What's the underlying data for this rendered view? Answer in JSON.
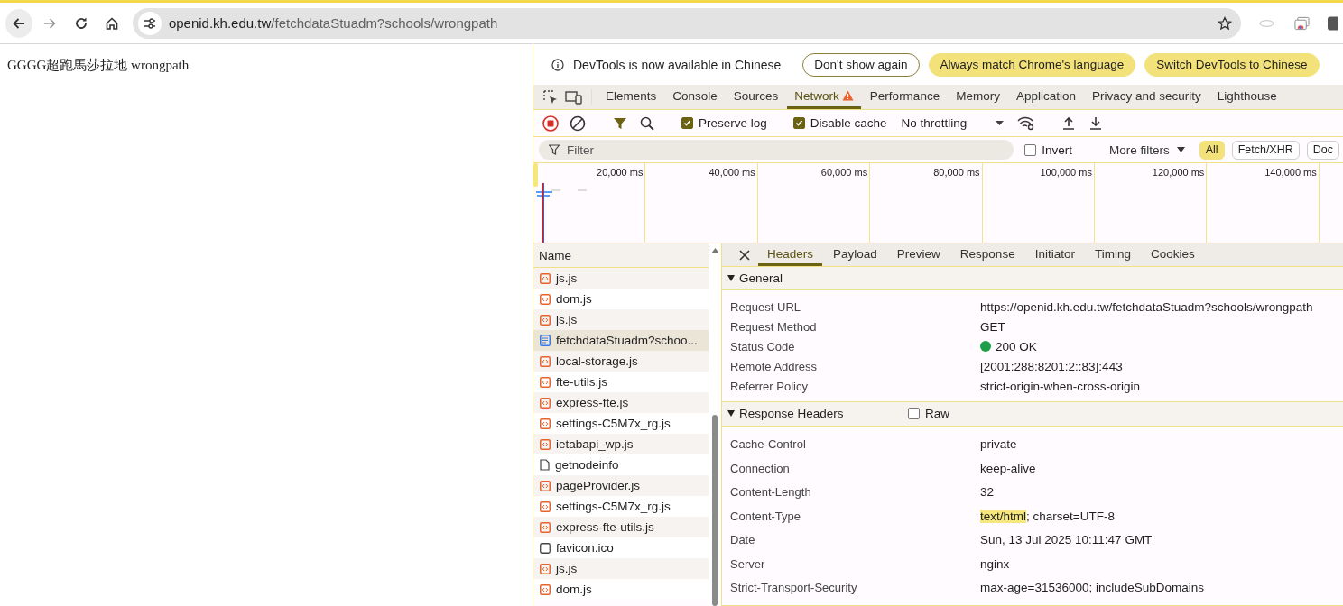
{
  "browser": {
    "url_host": "openid.kh.edu.tw",
    "url_path": "/fetchdataStuadm?schools/wrongpath"
  },
  "page": {
    "text": "GGGG超跑馬莎拉地 wrongpath"
  },
  "infobar": {
    "message": "DevTools is now available in Chinese",
    "buttons": [
      {
        "label": "Don't show again",
        "kind": "outline"
      },
      {
        "label": "Always match Chrome's language",
        "kind": "filled"
      },
      {
        "label": "Switch DevTools to Chinese",
        "kind": "filled"
      }
    ]
  },
  "panels": [
    {
      "label": "Elements",
      "selected": false,
      "warning": false
    },
    {
      "label": "Console",
      "selected": false,
      "warning": false
    },
    {
      "label": "Sources",
      "selected": false,
      "warning": false
    },
    {
      "label": "Network",
      "selected": true,
      "warning": true
    },
    {
      "label": "Performance",
      "selected": false,
      "warning": false
    },
    {
      "label": "Memory",
      "selected": false,
      "warning": false
    },
    {
      "label": "Application",
      "selected": false,
      "warning": false
    },
    {
      "label": "Privacy and security",
      "selected": false,
      "warning": false
    },
    {
      "label": "Lighthouse",
      "selected": false,
      "warning": false
    }
  ],
  "toolbar": {
    "recording": true,
    "options": [
      {
        "label": "Preserve log",
        "checked": true
      },
      {
        "label": "Disable cache",
        "checked": true
      }
    ],
    "throttling": "No throttling"
  },
  "filter": {
    "placeholder": "Filter",
    "invert": {
      "label": "Invert",
      "checked": false
    },
    "more_filters": "More filters",
    "types": [
      {
        "label": "All",
        "selected": true
      },
      {
        "label": "Fetch/XHR",
        "selected": false
      },
      {
        "label": "Doc",
        "selected": false
      }
    ]
  },
  "timeline": {
    "ticks": [
      "20,000 ms",
      "40,000 ms",
      "60,000 ms",
      "80,000 ms",
      "100,000 ms",
      "120,000 ms",
      "140,000 ms"
    ]
  },
  "requests": {
    "header": "Name",
    "items": [
      {
        "name": "js.js",
        "kind": "script",
        "selected": false
      },
      {
        "name": "dom.js",
        "kind": "script",
        "selected": false
      },
      {
        "name": "js.js",
        "kind": "script",
        "selected": false
      },
      {
        "name": "fetchdataStuadm?schoo...",
        "kind": "document",
        "selected": true
      },
      {
        "name": "local-storage.js",
        "kind": "script",
        "selected": false
      },
      {
        "name": "fte-utils.js",
        "kind": "script",
        "selected": false
      },
      {
        "name": "express-fte.js",
        "kind": "script",
        "selected": false
      },
      {
        "name": "settings-C5M7x_rg.js",
        "kind": "script",
        "selected": false
      },
      {
        "name": "ietabapi_wp.js",
        "kind": "script",
        "selected": false
      },
      {
        "name": "getnodeinfo",
        "kind": "fetch",
        "selected": false
      },
      {
        "name": "pageProvider.js",
        "kind": "script",
        "selected": false
      },
      {
        "name": "settings-C5M7x_rg.js",
        "kind": "script",
        "selected": false
      },
      {
        "name": "express-fte-utils.js",
        "kind": "script",
        "selected": false
      },
      {
        "name": "favicon.ico",
        "kind": "other",
        "selected": false
      },
      {
        "name": "js.js",
        "kind": "script",
        "selected": false
      },
      {
        "name": "dom.js",
        "kind": "script",
        "selected": false
      }
    ]
  },
  "details": {
    "tabs": [
      {
        "label": "Headers",
        "selected": true
      },
      {
        "label": "Payload",
        "selected": false
      },
      {
        "label": "Preview",
        "selected": false
      },
      {
        "label": "Response",
        "selected": false
      },
      {
        "label": "Initiator",
        "selected": false
      },
      {
        "label": "Timing",
        "selected": false
      },
      {
        "label": "Cookies",
        "selected": false
      }
    ],
    "sections": [
      {
        "title": "General",
        "expanded": true,
        "rows": [
          {
            "name": "Request URL",
            "value": "https://openid.kh.edu.tw/fetchdataStuadm?schools/wrongpath"
          },
          {
            "name": "Request Method",
            "value": "GET"
          },
          {
            "name": "Status Code",
            "value": "200 OK",
            "kind": "status"
          },
          {
            "name": "Remote Address",
            "value": "[2001:288:8201:2::83]:443"
          },
          {
            "name": "Referrer Policy",
            "value": "strict-origin-when-cross-origin"
          }
        ]
      },
      {
        "title": "Response Headers",
        "expanded": true,
        "raw": {
          "label": "Raw",
          "checked": false
        },
        "rows": [
          {
            "name": "Cache-Control",
            "value": "private"
          },
          {
            "name": "Connection",
            "value": "keep-alive"
          },
          {
            "name": "Content-Length",
            "value": "32"
          },
          {
            "name": "Content-Type",
            "highlight": "text/html",
            "value": "; charset=UTF-8"
          },
          {
            "name": "Date",
            "value": "Sun, 13 Jul 2025 10:11:47 GMT"
          },
          {
            "name": "Server",
            "value": "nginx"
          },
          {
            "name": "Strict-Transport-Security",
            "value": "max-age=31536000; includeSubDomains"
          }
        ]
      }
    ]
  }
}
